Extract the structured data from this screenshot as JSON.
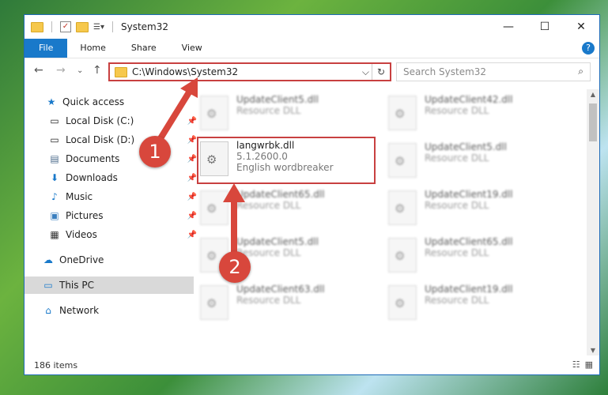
{
  "window": {
    "title": "System32",
    "controls": {
      "minimize": "—",
      "maximize": "☐",
      "close": "✕"
    }
  },
  "ribbon": {
    "tabs": [
      "File",
      "Home",
      "Share",
      "View"
    ],
    "help": "?"
  },
  "address_bar": {
    "path": "C:\\Windows\\System32",
    "dropdown": "⌵",
    "refresh": "↻"
  },
  "search": {
    "placeholder": "Search System32",
    "icon": "⌕"
  },
  "nav_buttons": {
    "back": "←",
    "forward": "→",
    "recent": "⌄",
    "up": "↑"
  },
  "sidebar": {
    "items": [
      {
        "label": "Quick access",
        "icon": "star-icon",
        "pinned": false
      },
      {
        "label": "Local Disk (C:)",
        "icon": "drive-icon",
        "pinned": true
      },
      {
        "label": "Local Disk (D:)",
        "icon": "drive-icon",
        "pinned": true
      },
      {
        "label": "Documents",
        "icon": "documents-icon",
        "pinned": true
      },
      {
        "label": "Downloads",
        "icon": "download-icon",
        "pinned": true
      },
      {
        "label": "Music",
        "icon": "music-icon",
        "pinned": true
      },
      {
        "label": "Pictures",
        "icon": "pictures-icon",
        "pinned": true
      },
      {
        "label": "Videos",
        "icon": "videos-icon",
        "pinned": true
      },
      {
        "label": "OneDrive",
        "icon": "cloud-icon",
        "pinned": false
      },
      {
        "label": "This PC",
        "icon": "computer-icon",
        "pinned": false
      },
      {
        "label": "Network",
        "icon": "network-icon",
        "pinned": false
      }
    ],
    "selected": "This PC"
  },
  "files": {
    "left": [
      {
        "name": "UpdateClient5.dll",
        "type": "Resource DLL"
      },
      {
        "name": "langwrbk.dll",
        "version": "5.1.2600.0",
        "description": "English wordbreaker"
      },
      {
        "name": "UpdateClient65.dll",
        "type": "Resource DLL"
      },
      {
        "name": "UpdateClient5.dll",
        "type": "Resource DLL"
      },
      {
        "name": "UpdateClient63.dll",
        "type": "Resource DLL"
      }
    ],
    "right": [
      {
        "name": "UpdateClient42.dll",
        "type": "Resource DLL"
      },
      {
        "name": "UpdateClient5.dll",
        "type": "Resource DLL"
      },
      {
        "name": "UpdateClient19.dll",
        "type": "Resource DLL"
      },
      {
        "name": "UpdateClient65.dll",
        "type": "Resource DLL"
      },
      {
        "name": "UpdateClient19.dll",
        "type": "Resource DLL"
      }
    ]
  },
  "status": {
    "item_count": "186 items"
  },
  "annotations": {
    "step1": "1",
    "step2": "2",
    "color": "#d8473c"
  }
}
